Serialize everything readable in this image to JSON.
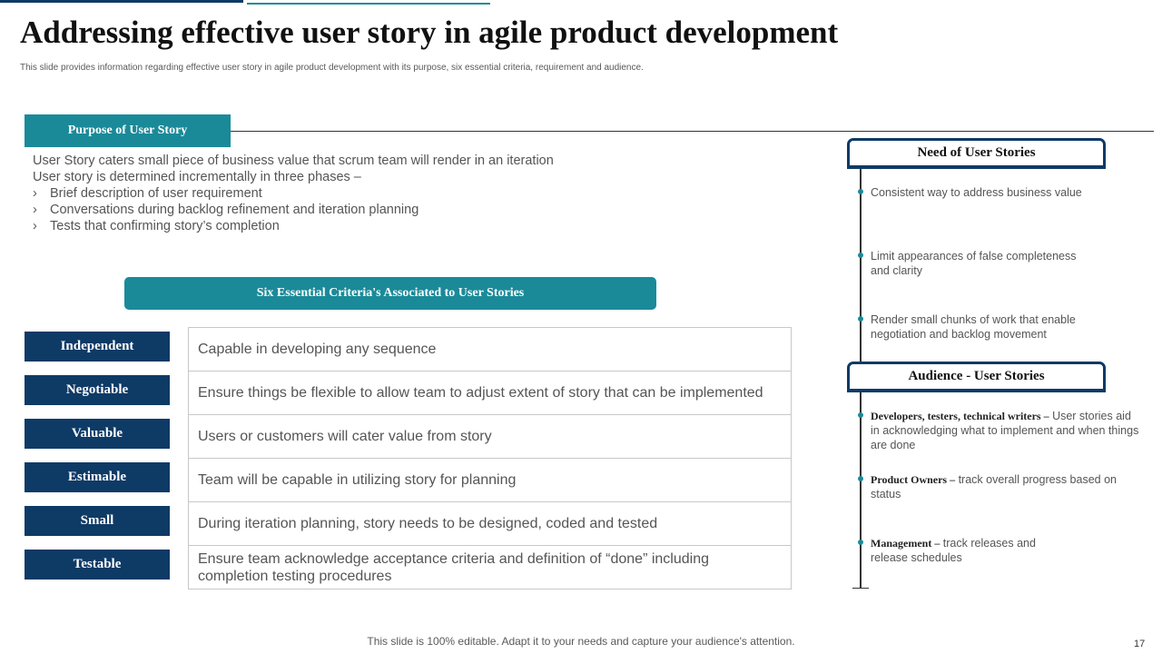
{
  "title": "Addressing effective user story in agile product development",
  "subtitle": "This slide provides information regarding effective user story in agile product development with its purpose, six essential criteria, requirement and audience.",
  "purpose": {
    "header": "Purpose  of User Story",
    "lines": [
      "User Story caters small piece of business value that scrum team will render in an iteration",
      "User story is determined incrementally in three phases –"
    ],
    "bullet_glyph": "›",
    "bullets": [
      "Brief description of user requirement",
      "Conversations during backlog refinement and iteration planning",
      "Tests that confirming story’s completion"
    ]
  },
  "criteria": {
    "header": "Six Essential Criteria's  Associated to User Stories",
    "items": [
      {
        "label": "Independent",
        "description": "Capable in developing any sequence"
      },
      {
        "label": "Negotiable",
        "description": "Ensure things be flexible to allow team to adjust extent of story that can be implemented"
      },
      {
        "label": "Valuable",
        "description": "Users or customers will cater value from story"
      },
      {
        "label": "Estimable",
        "description": "Team will be capable in utilizing story for planning"
      },
      {
        "label": "Small",
        "description": "During iteration planning, story needs to be designed, coded and tested"
      },
      {
        "label": "Testable",
        "description": "Ensure team acknowledge acceptance criteria and definition of “done” including completion testing procedures"
      }
    ]
  },
  "need": {
    "header": "Need of User Stories",
    "items": [
      "Consistent way to address business value",
      "Limit appearances of false completeness and clarity",
      "Render small chunks of work that enable negotiation and backlog movement"
    ]
  },
  "audience": {
    "header": "Audience  - User Stories",
    "items": [
      {
        "lead": "Developers,  testers, technical writers –",
        "text": " User stories aid in acknowledging  what to implement and when things are done"
      },
      {
        "lead": "Product Owners –",
        "text": " track overall progress based on status"
      },
      {
        "lead": "Management  –",
        "text": " track releases and release schedules"
      }
    ]
  },
  "footer": "This slide is 100% editable. Adapt it to your needs and capture your audience's attention.",
  "page_number": "17",
  "colors": {
    "teal": "#1a8a99",
    "navy": "#0e3a66"
  }
}
